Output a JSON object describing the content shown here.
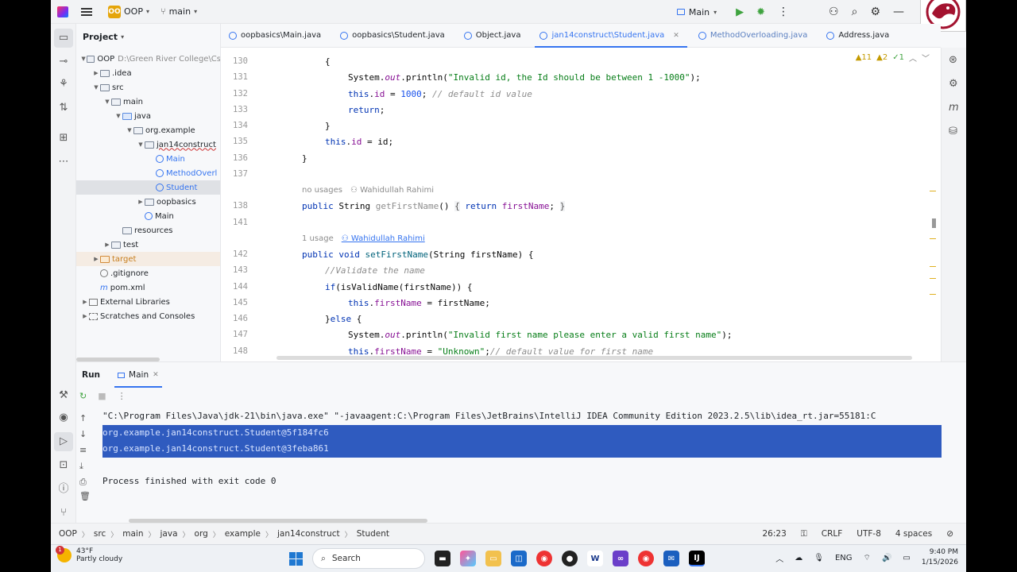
{
  "titlebar": {
    "project_badge": "OO",
    "project_name": "OOP",
    "branch": "main",
    "run_config": "Main"
  },
  "project_panel": {
    "title": "Project",
    "tree": [
      {
        "label": "OOP",
        "suffix": "D:\\Green River College\\Cs",
        "indent": 0,
        "arrow": "down",
        "icon": "folder",
        "style": "bold"
      },
      {
        "label": ".idea",
        "indent": 1,
        "arrow": "right",
        "icon": "folder"
      },
      {
        "label": "src",
        "indent": 1,
        "arrow": "down",
        "icon": "folder"
      },
      {
        "label": "main",
        "indent": 2,
        "arrow": "down",
        "icon": "folder"
      },
      {
        "label": "java",
        "indent": 3,
        "arrow": "down",
        "icon": "folder-blue"
      },
      {
        "label": "org.example",
        "indent": 4,
        "arrow": "down",
        "icon": "folder"
      },
      {
        "label": "jan14construct",
        "indent": 5,
        "arrow": "down",
        "icon": "folder"
      },
      {
        "label": "Main",
        "indent": 6,
        "arrow": "",
        "icon": "class",
        "style": "blue"
      },
      {
        "label": "MethodOverl",
        "indent": 6,
        "arrow": "",
        "icon": "class",
        "style": "blue"
      },
      {
        "label": "Student",
        "indent": 6,
        "arrow": "",
        "icon": "class",
        "style": "blue",
        "selected": true
      },
      {
        "label": "oopbasics",
        "indent": 5,
        "arrow": "right",
        "icon": "folder"
      },
      {
        "label": "Main",
        "indent": 5,
        "arrow": "",
        "icon": "class"
      },
      {
        "label": "resources",
        "indent": 3,
        "arrow": "",
        "icon": "folder"
      },
      {
        "label": "test",
        "indent": 2,
        "arrow": "right",
        "icon": "folder"
      },
      {
        "label": "target",
        "indent": 1,
        "arrow": "right",
        "icon": "folder-orange",
        "style": "orange",
        "highlight": true
      },
      {
        "label": ".gitignore",
        "indent": 1,
        "arrow": "",
        "icon": "ignore"
      },
      {
        "label": "pom.xml",
        "indent": 1,
        "arrow": "",
        "icon": "maven"
      },
      {
        "label": "External Libraries",
        "indent": 0,
        "arrow": "right",
        "icon": "lib"
      },
      {
        "label": "Scratches and Consoles",
        "indent": 0,
        "arrow": "right",
        "icon": "scratch"
      }
    ]
  },
  "tabs": [
    {
      "label": "oopbasics\\Main.java"
    },
    {
      "label": "oopbasics\\Student.java"
    },
    {
      "label": "Object.java"
    },
    {
      "label": "jan14construct\\Student.java",
      "active": true
    },
    {
      "label": "MethodOverloading.java"
    },
    {
      "label": "Address.java"
    }
  ],
  "inspections": {
    "warnings": "11",
    "weak": "2",
    "ok": "1"
  },
  "editor": {
    "lines": [
      {
        "num": "130",
        "code": "{",
        "indent": 1
      },
      {
        "num": "131",
        "code": "System.out.println(\"Invalid id, the Id should be between 1 -1000\");",
        "indent": 2
      },
      {
        "num": "132",
        "code": "this.id = 1000; // default id value",
        "indent": 2
      },
      {
        "num": "133",
        "code": "return;",
        "indent": 2
      },
      {
        "num": "134",
        "code": "}",
        "indent": 1
      },
      {
        "num": "135",
        "code": "this.id = id;",
        "indent": 1
      },
      {
        "num": "136",
        "code": "}",
        "indent": 0
      },
      {
        "num": "137",
        "code": "",
        "indent": 0
      },
      {
        "num": "",
        "hint": "no usages",
        "author": "Wahidullah Rahimi"
      },
      {
        "num": "138",
        "code": "public String getFirstName() { return firstName; }",
        "indent": 0
      },
      {
        "num": "141",
        "code": "",
        "indent": 0
      },
      {
        "num": "",
        "hint": "1 usage",
        "author": "Wahidullah Rahimi"
      },
      {
        "num": "142",
        "code": "public void setFirstName(String firstName) {",
        "indent": 0
      },
      {
        "num": "143",
        "code": "//Validate the name",
        "indent": 1
      },
      {
        "num": "144",
        "code": "if(isValidName(firstName)) {",
        "indent": 1
      },
      {
        "num": "145",
        "code": "this.firstName = firstName;",
        "indent": 2
      },
      {
        "num": "146",
        "code": "}else {",
        "indent": 1
      },
      {
        "num": "147",
        "code": "System.out.println(\"Invalid first name please enter a valid first name\");",
        "indent": 2
      },
      {
        "num": "148",
        "code": "this.firstName = \"Unknown\";// default value for first name",
        "indent": 2
      }
    ]
  },
  "run_panel": {
    "tab_run": "Run",
    "tab_main": "Main",
    "console": [
      {
        "text": "\"C:\\Program Files\\Java\\jdk-21\\bin\\java.exe\" \"-javaagent:C:\\Program Files\\JetBrains\\IntelliJ IDEA Community Edition 2023.2.5\\lib\\idea_rt.jar=55181:C"
      },
      {
        "text": "org.example.jan14construct.Student@5f184fc6",
        "selected": true
      },
      {
        "text": "org.example.jan14construct.Student@3feba861",
        "selected": true
      },
      {
        "text": ""
      },
      {
        "text": "Process finished with exit code 0"
      }
    ]
  },
  "statusbar": {
    "breadcrumbs": [
      "OOP",
      "src",
      "main",
      "java",
      "org",
      "example",
      "jan14construct",
      "Student"
    ],
    "position": "26:23",
    "line_ending": "CRLF",
    "encoding": "UTF-8",
    "indent": "4 spaces"
  },
  "taskbar": {
    "temp": "43°F",
    "weather": "Partly cloudy",
    "notification_count": "1",
    "search_placeholder": "Search",
    "lang": "ENG",
    "time": "9:40 PM",
    "date": "1/15/2026"
  }
}
